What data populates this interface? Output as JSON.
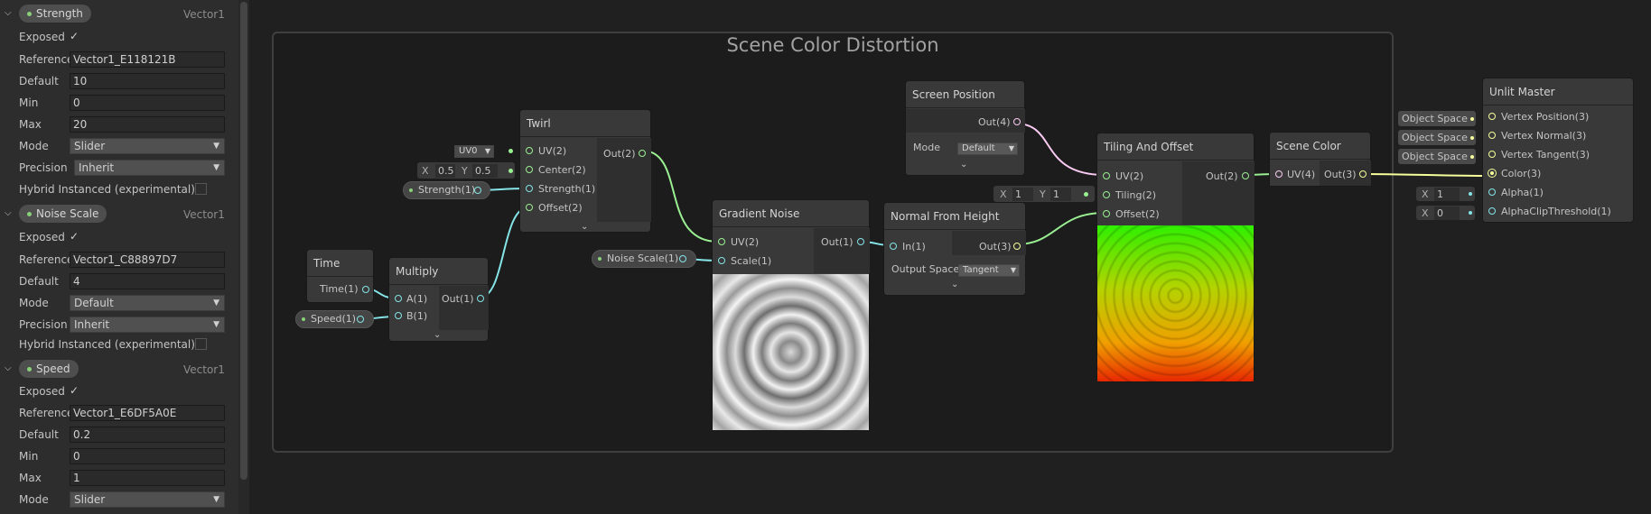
{
  "blackboard": {
    "properties": [
      {
        "name": "Strength",
        "type": "Vector1",
        "exposed_label": "Exposed",
        "exposed": "✓",
        "reference_label": "Reference",
        "reference": "Vector1_E118121B",
        "default_label": "Default",
        "default": "10",
        "min_label": "Min",
        "min": "0",
        "max_label": "Max",
        "max": "20",
        "mode_label": "Mode",
        "mode": "Slider",
        "precision_label": "Precision",
        "precision": "Inherit",
        "hybrid_label": "Hybrid Instanced (experimental)"
      },
      {
        "name": "Noise Scale",
        "type": "Vector1",
        "exposed_label": "Exposed",
        "exposed": "✓",
        "reference_label": "Reference",
        "reference": "Vector1_C88897D7",
        "default_label": "Default",
        "default": "4",
        "mode_label": "Mode",
        "mode": "Default",
        "precision_label": "Precision",
        "precision": "Inherit",
        "hybrid_label": "Hybrid Instanced (experimental)"
      },
      {
        "name": "Speed",
        "type": "Vector1",
        "exposed_label": "Exposed",
        "exposed": "✓",
        "reference_label": "Reference",
        "reference": "Vector1_E6DF5A0E",
        "default_label": "Default",
        "default": "0.2",
        "min_label": "Min",
        "min": "0",
        "max_label": "Max",
        "max": "1",
        "mode_label": "Mode",
        "mode": "Slider"
      }
    ]
  },
  "graph": {
    "group_title": "Scene Color Distortion",
    "nodes": {
      "time": {
        "title": "Time",
        "out": "Time(1)"
      },
      "multiply": {
        "title": "Multiply",
        "in_a": "A(1)",
        "in_b": "B(1)",
        "out": "Out(1)"
      },
      "twirl": {
        "title": "Twirl",
        "in_uv": "UV(2)",
        "in_center": "Center(2)",
        "in_strength": "Strength(1)",
        "in_offset": "Offset(2)",
        "out": "Out(2)",
        "uv_default": "UV0",
        "center_x_label": "X",
        "center_x": "0.5",
        "center_y_label": "Y",
        "center_y": "0.5"
      },
      "gradient_noise": {
        "title": "Gradient Noise",
        "in_uv": "UV(2)",
        "in_scale": "Scale(1)",
        "out": "Out(1)"
      },
      "screen_position": {
        "title": "Screen Position",
        "out": "Out(4)",
        "mode_label": "Mode",
        "mode": "Default"
      },
      "normal_from_height": {
        "title": "Normal From Height",
        "in": "In(1)",
        "out": "Out(3)",
        "space_label": "Output Space",
        "space": "Tangent"
      },
      "tiling_offset": {
        "title": "Tiling And Offset",
        "in_uv": "UV(2)",
        "in_tiling": "Tiling(2)",
        "in_offset": "Offset(2)",
        "out": "Out(2)",
        "tiling_x_label": "X",
        "tiling_x": "1",
        "tiling_y_label": "Y",
        "tiling_y": "1"
      },
      "scene_color": {
        "title": "Scene Color",
        "in_uv": "UV(4)",
        "out": "Out(3)"
      },
      "unlit_master": {
        "title": "Unlit Master",
        "ports": [
          "Vertex Position(3)",
          "Vertex Normal(3)",
          "Vertex Tangent(3)",
          "Color(3)",
          "Alpha(1)",
          "AlphaClipThreshold(1)"
        ],
        "space_chips": [
          "Object Space",
          "Object Space",
          "Object Space"
        ],
        "alpha_x_label": "X",
        "alpha": "1",
        "clip_x_label": "X",
        "clip": "0"
      }
    },
    "property_nodes": {
      "strength": "Strength(1)",
      "speed": "Speed(1)",
      "noise_scale": "Noise Scale(1)"
    }
  },
  "colors": {
    "vector1": "#84e4e7",
    "vector2": "#9aef92",
    "vector3": "#f6ff9a",
    "vector4": "#fbcbf4",
    "property_dot": "#8ad07a"
  }
}
